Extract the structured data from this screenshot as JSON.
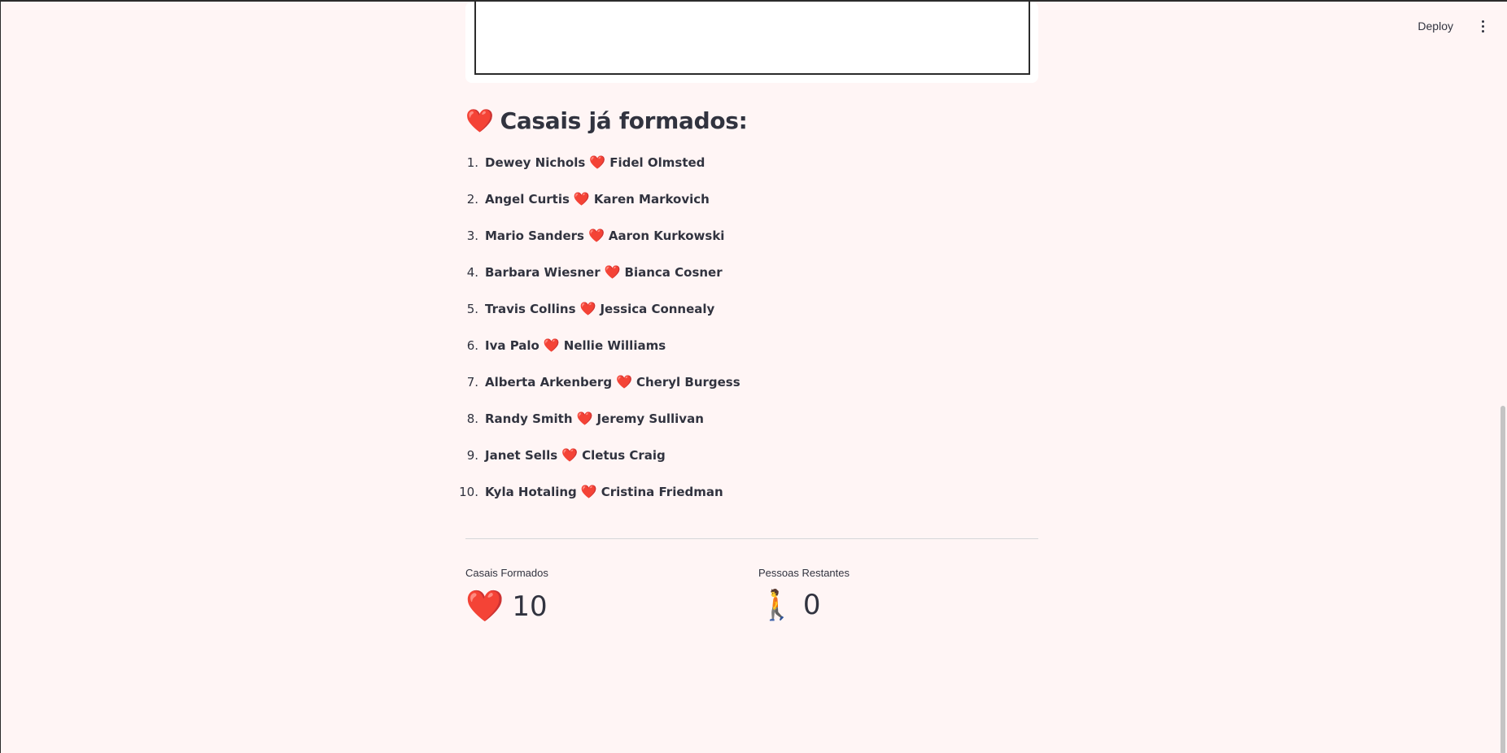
{
  "header": {
    "deploy_label": "Deploy",
    "menu_icon": "more-vertical-icon"
  },
  "section": {
    "title": "Casais já formados:",
    "icon": "heart-icon"
  },
  "couples": [
    {
      "num": "1.",
      "a": "Dewey Nichols",
      "b": "Fidel Olmsted"
    },
    {
      "num": "2.",
      "a": "Angel Curtis",
      "b": "Karen Markovich"
    },
    {
      "num": "3.",
      "a": "Mario Sanders",
      "b": "Aaron Kurkowski"
    },
    {
      "num": "4.",
      "a": "Barbara Wiesner",
      "b": "Bianca Cosner"
    },
    {
      "num": "5.",
      "a": "Travis Collins",
      "b": "Jessica Connealy"
    },
    {
      "num": "6.",
      "a": "Iva Palo",
      "b": "Nellie Williams"
    },
    {
      "num": "7.",
      "a": "Alberta Arkenberg",
      "b": "Cheryl Burgess"
    },
    {
      "num": "8.",
      "a": "Randy Smith",
      "b": "Jeremy Sullivan"
    },
    {
      "num": "9.",
      "a": "Janet Sells",
      "b": "Cletus Craig"
    },
    {
      "num": "10.",
      "a": "Kyla Hotaling",
      "b": "Cristina Friedman"
    }
  ],
  "metrics": {
    "couples_formed": {
      "label": "Casais Formados",
      "value": "10",
      "icon": "heart-icon"
    },
    "people_remaining": {
      "label": "Pessoas Restantes",
      "value": "0",
      "icon": "person-walking-icon"
    }
  },
  "colors": {
    "background": "#fff5f5",
    "text": "#31333f",
    "heart": "#e0202a"
  }
}
